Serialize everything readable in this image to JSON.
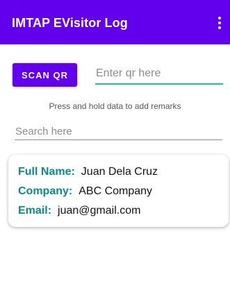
{
  "app_bar": {
    "title": "IMTAP EVisitor Log",
    "overflow_icon": "more-vert-icon"
  },
  "scan": {
    "button_label": "SCAN QR",
    "input_placeholder": "Enter qr here",
    "input_value": ""
  },
  "hint": "Press and hold data to add remarks",
  "search": {
    "placeholder": "Search here",
    "value": ""
  },
  "records": [
    {
      "name_label": "Full Name:",
      "name": "Juan Dela Cruz",
      "company_label": "Company:",
      "company": "ABC Company",
      "email_label": "Email:",
      "email": "juan@gmail.com"
    }
  ],
  "colors": {
    "primary": "#6200ee",
    "accent": "#26b7a9",
    "label": "#0a8a8a"
  }
}
